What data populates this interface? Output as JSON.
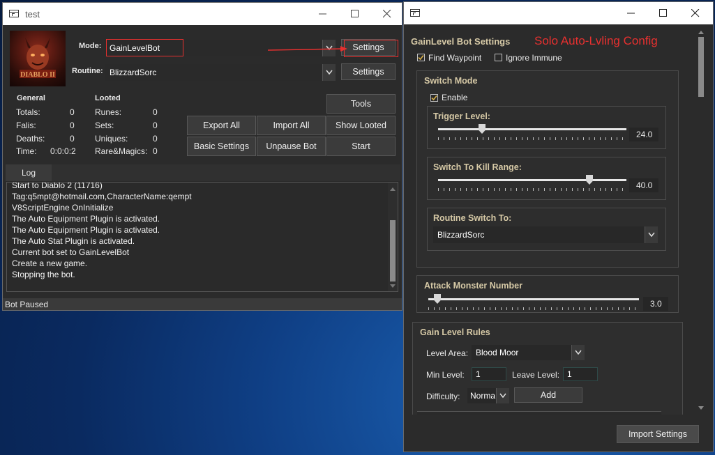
{
  "main_window": {
    "title": "test",
    "mode_label": "Mode:",
    "mode_value": "GainLevelBot",
    "mode_settings": "Settings",
    "routine_label": "Routine:",
    "routine_value": "BlizzardSorc",
    "routine_settings": "Settings",
    "general_header": "General",
    "looted_header": "Looted",
    "stats": [
      {
        "label": "Totals:",
        "value": "0"
      },
      {
        "label": "Falis:",
        "value": "0"
      },
      {
        "label": "Deaths:",
        "value": "0"
      },
      {
        "label": "Time:",
        "value": "0:0:0:2"
      }
    ],
    "looted": [
      {
        "label": "Runes:",
        "value": "0"
      },
      {
        "label": "Sets:",
        "value": "0"
      },
      {
        "label": "Uniques:",
        "value": "0"
      },
      {
        "label": "Rare&Magics:",
        "value": "0"
      }
    ],
    "buttons": {
      "tools": "Tools",
      "export_all": "Export All",
      "import_all": "Import All",
      "show_looted": "Show Looted",
      "basic_settings": "Basic Settings",
      "unpause_bot": "Unpause Bot",
      "start": "Start"
    },
    "log_tab": "Log",
    "log_lines": [
      "Start to Diablo 2 (11716)",
      "Tag:q5mpt@hotmail.com,CharacterName:qempt",
      "V8ScriptEngine OnInitialize",
      "The Auto Equipment Plugin is activated.",
      "The Auto Equipment Plugin is activated.",
      "The Auto Stat Plugin is activated.",
      "Current bot set to GainLevelBot",
      "Create a new game.",
      "Stopping the bot."
    ],
    "status": "Bot Paused"
  },
  "settings_window": {
    "header": "GainLevel Bot Settings",
    "annotation": "Solo Auto-Lvling Config",
    "find_waypoint": {
      "label": "Find Waypoint",
      "checked": true
    },
    "ignore_immune": {
      "label": "Ignore Immune",
      "checked": false
    },
    "switch_mode": {
      "title": "Switch Mode",
      "enable": {
        "label": "Enable",
        "checked": true
      },
      "trigger_level": {
        "title": "Trigger Level:",
        "value": "24.0",
        "level": 0.24
      },
      "kill_range": {
        "title": "Switch To Kill Range:",
        "value": "40.0",
        "level": 0.8
      },
      "routine_switch": {
        "title": "Routine Switch To:",
        "value": "BlizzardSorc"
      }
    },
    "attack_monster": {
      "title": "Attack Monster Number",
      "value": "3.0",
      "level": 0.03
    },
    "gain_level_rules": {
      "title": "Gain Level Rules",
      "level_area_label": "Level Area:",
      "level_area_value": "Blood Moor",
      "min_level_label": "Min Level:",
      "min_level_value": "1",
      "leave_level_label": "Leave Level:",
      "leave_level_value": "1",
      "difficulty_label": "Difficulty:",
      "difficulty_value": "Normal",
      "add_button": "Add"
    },
    "import_button": "Import Settings"
  },
  "colors": {
    "accent_red": "#e8302f",
    "window_bg": "#2b2b2b",
    "section_title": "#d6c9a6",
    "desktop": "#0f3f85"
  }
}
